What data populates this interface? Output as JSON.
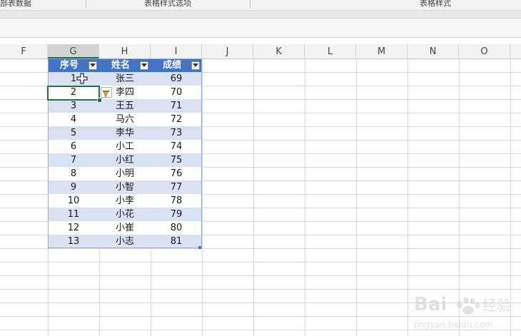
{
  "ribbon": {
    "groups": [
      {
        "label": "部表数据"
      },
      {
        "label": "表格样式选项"
      },
      {
        "label": "表格样式"
      }
    ]
  },
  "grid": {
    "columns": [
      "F",
      "G",
      "H",
      "I",
      "J",
      "K",
      "L",
      "M",
      "N",
      "O"
    ],
    "selected_column": "G"
  },
  "table": {
    "headers": [
      "序号",
      "姓名",
      "成绩"
    ],
    "rows": [
      [
        "1",
        "张三",
        "69"
      ],
      [
        "2",
        "李四",
        "70"
      ],
      [
        "3",
        "王五",
        "71"
      ],
      [
        "4",
        "马六",
        "72"
      ],
      [
        "5",
        "李华",
        "73"
      ],
      [
        "6",
        "小工",
        "74"
      ],
      [
        "7",
        "小红",
        "75"
      ],
      [
        "8",
        "小明",
        "76"
      ],
      [
        "9",
        "小智",
        "77"
      ],
      [
        "10",
        "小李",
        "78"
      ],
      [
        "11",
        "小花",
        "79"
      ],
      [
        "12",
        "小崔",
        "80"
      ],
      [
        "13",
        "小志",
        "81"
      ]
    ],
    "active_cell": "G2"
  },
  "colors": {
    "header_fill": "#4472c4",
    "band_fill": "#d9e1f2",
    "selection": "#217346"
  },
  "icons": [
    "filter-dropdown-icon",
    "cursor-cross-icon",
    "smart-tag-icon"
  ],
  "watermark": {
    "brand": "Bai",
    "suffix": "经验",
    "url": "jingyan.baidu.com"
  }
}
